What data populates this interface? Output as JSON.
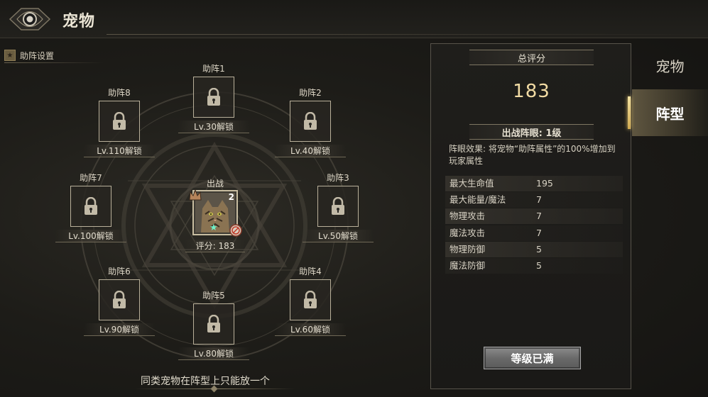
{
  "header": {
    "title": "宠物",
    "emblem_icon": "orb-emblem-icon"
  },
  "section": {
    "label": "助阵设置",
    "icon": "star-badge-icon"
  },
  "slots": [
    {
      "name": "助阵1",
      "level": "Lv.30解锁"
    },
    {
      "name": "助阵2",
      "level": "Lv.40解锁"
    },
    {
      "name": "助阵3",
      "level": "Lv.50解锁"
    },
    {
      "name": "助阵4",
      "level": "Lv.60解锁"
    },
    {
      "name": "助阵5",
      "level": "Lv.80解锁"
    },
    {
      "name": "助阵6",
      "level": "Lv.90解锁"
    },
    {
      "name": "助阵7",
      "level": "Lv.100解锁"
    },
    {
      "name": "助阵8",
      "level": "Lv.110解锁"
    }
  ],
  "active": {
    "label": "出战",
    "count": "2",
    "score": "评分: 183",
    "star": "★"
  },
  "bottom_note": "同类宠物在阵型上只能放一个",
  "panel": {
    "total_label": "总评分",
    "total_score": "183",
    "eye_label": "出战阵眼: 1级",
    "eye_effect": "阵眼效果: 将宠物“助阵属性”的100%增加到玩家属性",
    "stats": [
      {
        "name": "最大生命值",
        "value": "195"
      },
      {
        "name": "最大能量/魔法",
        "value": "7"
      },
      {
        "name": "物理攻击",
        "value": "7"
      },
      {
        "name": "魔法攻击",
        "value": "7"
      },
      {
        "name": "物理防御",
        "value": "5"
      },
      {
        "name": "魔法防御",
        "value": "5"
      }
    ],
    "button_label": "等级已满"
  },
  "tabs": {
    "pet": "宠物",
    "formation": "阵型"
  },
  "colors": {
    "accent_gold": "#f2dca4",
    "active_tab": "#5f5640",
    "button_grey": "#6a6a6a"
  }
}
